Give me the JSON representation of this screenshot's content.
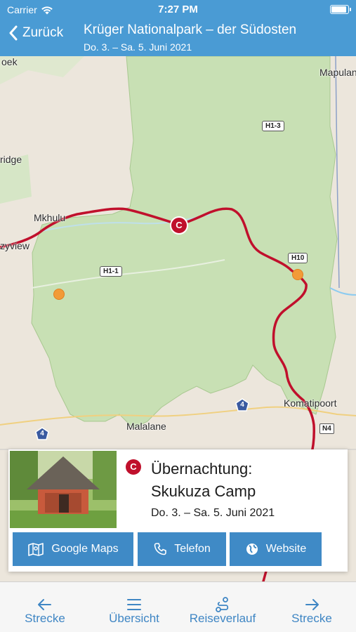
{
  "status": {
    "carrier": "Carrier",
    "time": "7:27 PM"
  },
  "nav": {
    "back_label": "Zurück",
    "title": "Krüger Nationalpark – der Südosten",
    "dates": "Do. 3.  – Sa. 5. Juni 2021"
  },
  "map": {
    "labels": {
      "oek": "oek",
      "mapulana": "Mapulan",
      "ridge": "ridge",
      "mkhulu": "Mkhulu",
      "zyview": "zyview",
      "komatipoort": "Komatipoort",
      "malalane": "Malalane"
    },
    "roads": {
      "h1_3": "H1-3",
      "h10": "H10",
      "h1_1": "H1-1",
      "n4": "N4",
      "r4a": "4",
      "r4b": "4"
    },
    "camp_marker": "C",
    "colors": {
      "park": "#c8e0b4",
      "route": "#c0102c",
      "poi": "#f29b38",
      "water": "#8ccbf0"
    }
  },
  "card": {
    "marker": "C",
    "title_line1": "Übernachtung:",
    "title_line2": "Skukuza Camp",
    "dates": "Do. 3.  – Sa. 5. Juni 2021",
    "buttons": {
      "google_maps": "Google Maps",
      "telefon": "Telefon",
      "website": "Website"
    }
  },
  "tabbar": {
    "prev": "Strecke",
    "overview": "Übersicht",
    "itinerary": "Reiseverlauf",
    "next": "Strecke"
  },
  "accent": "#4a9bd4"
}
